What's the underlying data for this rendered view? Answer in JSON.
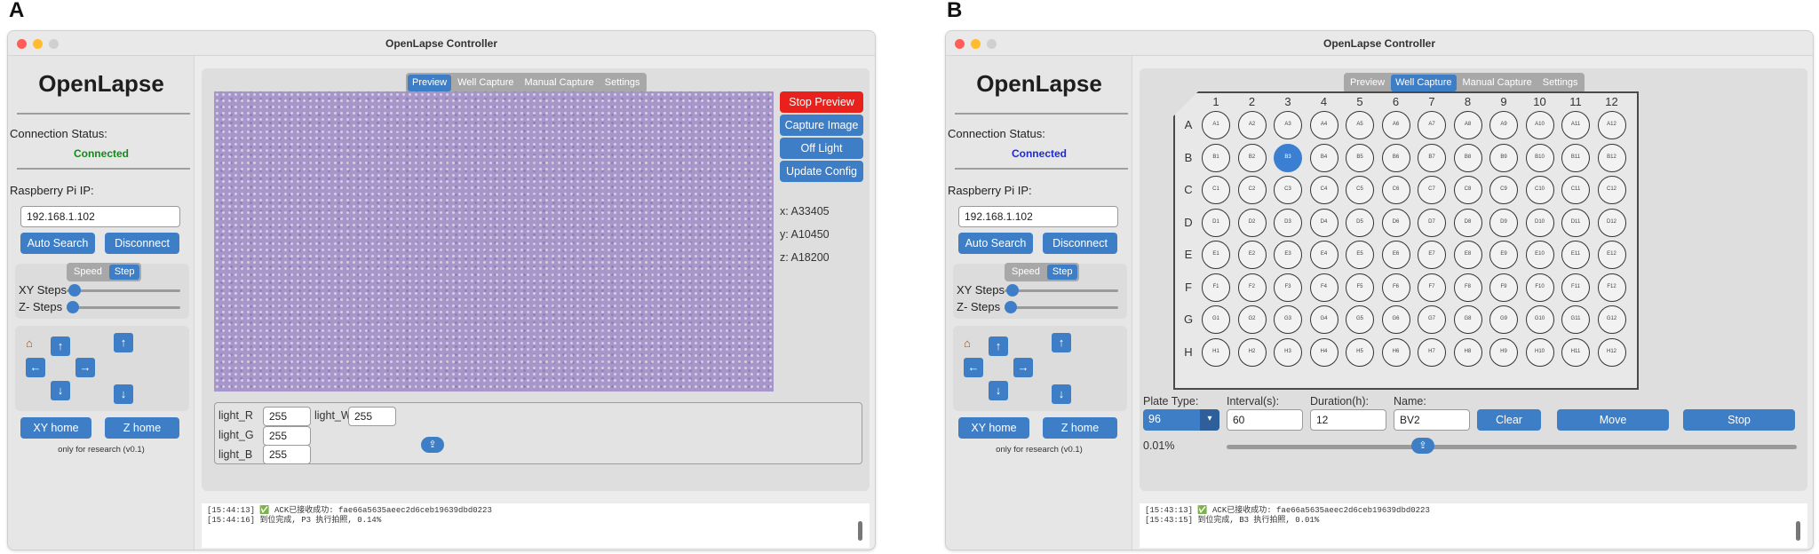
{
  "panels": [
    {
      "letter": "A",
      "window_title": "OpenLapse Controller",
      "sidebar": {
        "logo": "OpenLapse",
        "connection_label": "Connection Status:",
        "connection_value": "Connected",
        "connection_color": "#118a1a",
        "ip_label": "Raspberry Pi IP:",
        "ip_value": "192.168.1.102",
        "auto_search": "Auto Search",
        "disconnect": "Disconnect",
        "mode_options": [
          "Speed",
          "Step"
        ],
        "mode_selected": "Step",
        "xy_steps_label": "XY Steps",
        "z_steps_label": "Z- Steps",
        "xy_home": "XY home",
        "z_home": "Z home",
        "footer": "only for research (v0.1)"
      },
      "tabs": [
        "Preview",
        "Well Capture",
        "Manual Capture",
        "Settings"
      ],
      "active_tab": "Preview",
      "controls": {
        "stop_preview": "Stop Preview",
        "capture_image": "Capture Image",
        "off_light": "Off Light",
        "update_config": "Update Config"
      },
      "coords": {
        "x": "x: A33405",
        "y": "y: A10450",
        "z": "z: A18200"
      },
      "lights": {
        "r_label": "light_R",
        "r_value": "255",
        "g_label": "light_G",
        "g_value": "255",
        "b_label": "light_B",
        "b_value": "255",
        "w_label": "light_W",
        "w_value": "255"
      },
      "log": [
        "[15:44:13] ✅ ACK已接收成功: fae66a5635aeec2d6ceb19639dbd0223",
        "[15:44:16] 到位完成, P3 执行拍照, 0.14%"
      ]
    },
    {
      "letter": "B",
      "window_title": "OpenLapse Controller",
      "sidebar": {
        "logo": "OpenLapse",
        "connection_label": "Connection Status:",
        "connection_value": "Connected",
        "connection_color": "#1a2bd6",
        "ip_label": "Raspberry Pi IP:",
        "ip_value": "192.168.1.102",
        "auto_search": "Auto Search",
        "disconnect": "Disconnect",
        "mode_options": [
          "Speed",
          "Step"
        ],
        "mode_selected": "Step",
        "xy_steps_label": "XY Steps",
        "z_steps_label": "Z- Steps",
        "xy_home": "XY home",
        "z_home": "Z home",
        "footer": "only for research (v0.1)"
      },
      "tabs": [
        "Preview",
        "Well Capture",
        "Manual Capture",
        "Settings"
      ],
      "active_tab": "Well Capture",
      "plate": {
        "columns": [
          "1",
          "2",
          "3",
          "4",
          "5",
          "6",
          "7",
          "8",
          "9",
          "10",
          "11",
          "12"
        ],
        "rows": [
          "A",
          "B",
          "C",
          "D",
          "E",
          "F",
          "G",
          "H"
        ],
        "selected_well": "B3"
      },
      "form": {
        "plate_type_label": "Plate Type:",
        "plate_type_value": "96",
        "interval_label": "Interval(s):",
        "interval_value": "60",
        "duration_label": "Duration(h):",
        "duration_value": "12",
        "name_label": "Name:",
        "name_value": "BV2",
        "clear": "Clear",
        "move": "Move",
        "stop": "Stop"
      },
      "progress_text": "0.01%",
      "progress_fraction": 0.0001,
      "log": [
        "[15:43:13] ✅ ACK已接收成功: fae66a5635aeec2d6ceb19639dbd0223",
        "[15:43:15] 到位完成, B3 执行拍照, 0.01%"
      ]
    }
  ],
  "colors": {
    "accent": "#3e7ec6",
    "stop_red": "#e8211d",
    "close_dot": "#ff5f57",
    "min_dot": "#febc2e",
    "max_dot": "#d0d0d0"
  }
}
